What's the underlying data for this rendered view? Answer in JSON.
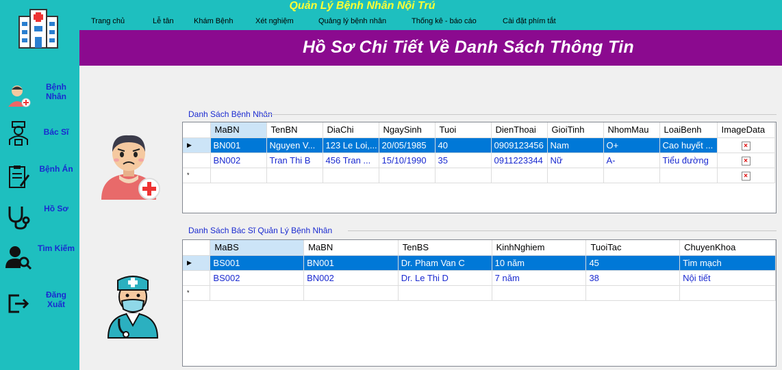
{
  "app_title": "Quản Lý Bệnh Nhân Nội Trú",
  "menu": [
    "Trang chủ",
    "Lễ tân",
    "Khám Bệnh",
    "Xét nghiệm",
    "Quảng lý bệnh nhân",
    "Thống kê - báo cáo",
    "Cài đặt phím tắt"
  ],
  "banner_title": "Hồ Sơ Chi Tiết Về Danh Sách Thông Tin",
  "sidebar": [
    {
      "label": "Bệnh Nhân",
      "icon": "patient-icon"
    },
    {
      "label": "Bác Sĩ",
      "icon": "doctor-icon"
    },
    {
      "label": "Bệnh Án",
      "icon": "medical-record-icon"
    },
    {
      "label": "Hồ Sơ",
      "icon": "stethoscope-icon"
    },
    {
      "label": "Tìm Kiếm",
      "icon": "user-search-icon"
    },
    {
      "label": "Đăng Xuất",
      "icon": "logout-icon"
    }
  ],
  "patients": {
    "label": "Danh Sách Bệnh Nhân",
    "columns": [
      "MaBN",
      "TenBN",
      "DiaChi",
      "NgaySinh",
      "Tuoi",
      "DienThoai",
      "GioiTinh",
      "NhomMau",
      "LoaiBenh",
      "ImageData"
    ],
    "rows": [
      [
        "BN001",
        "Nguyen V...",
        "123 Le Loi,...",
        "20/05/1985",
        "40",
        "0909123456",
        "Nam",
        "O+",
        "Cao huyết ..."
      ],
      [
        "BN002",
        "Tran Thi B",
        "456 Tran ...",
        "15/10/1990",
        "35",
        "0911223344",
        "Nữ",
        "A-",
        "Tiểu đường"
      ]
    ]
  },
  "doctors": {
    "label": "Danh Sách Bác Sĩ Quản Lý Bệnh Nhân",
    "columns": [
      "MaBS",
      "MaBN",
      "TenBS",
      "KinhNghiem",
      "TuoiTac",
      "ChuyenKhoa"
    ],
    "rows": [
      [
        "BS001",
        "BN001",
        "Dr. Pham Van C",
        "10 năm",
        "45",
        "Tim mạch"
      ],
      [
        "BS002",
        "BN002",
        "Dr. Le Thi D",
        "7 năm",
        "38",
        "Nội tiết"
      ]
    ]
  },
  "colors": {
    "teal": "#1ebfbf",
    "banner": "#8b0a8f",
    "title_yellow": "#ffff33",
    "selection": "#0078d7",
    "link_blue": "#1a2ad0"
  }
}
